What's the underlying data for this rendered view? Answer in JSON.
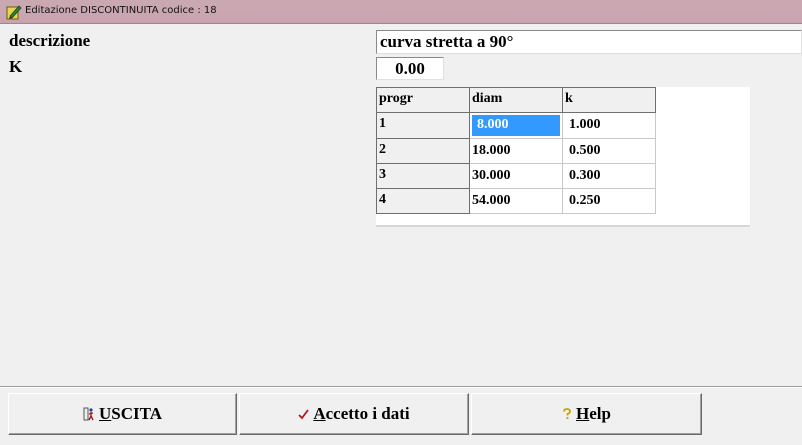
{
  "window": {
    "title": "Editazione DISCONTINUITA codice : 18"
  },
  "form": {
    "descrizione_label": "descrizione",
    "descrizione_value": "curva stretta a 90°",
    "k_label": "K",
    "k_value": "0.00"
  },
  "grid": {
    "columns": [
      "progr",
      "diam",
      "k"
    ],
    "rows": [
      {
        "progr": "1",
        "diam": "8.000",
        "k": "1.000"
      },
      {
        "progr": "2",
        "diam": "18.000",
        "k": "0.500"
      },
      {
        "progr": "3",
        "diam": "30.000",
        "k": "0.300"
      },
      {
        "progr": "4",
        "diam": "54.000",
        "k": "0.250"
      }
    ],
    "selection_color": "#3399ff"
  },
  "buttons": {
    "uscita": {
      "mnemonic": "U",
      "rest": "SCITA",
      "icon": "exit-person-icon"
    },
    "accetto": {
      "mnemonic": "A",
      "rest": "ccetto i dati",
      "icon": "checkmark-icon"
    },
    "help": {
      "mnemonic": "H",
      "rest": "elp",
      "icon": "question-icon"
    }
  }
}
